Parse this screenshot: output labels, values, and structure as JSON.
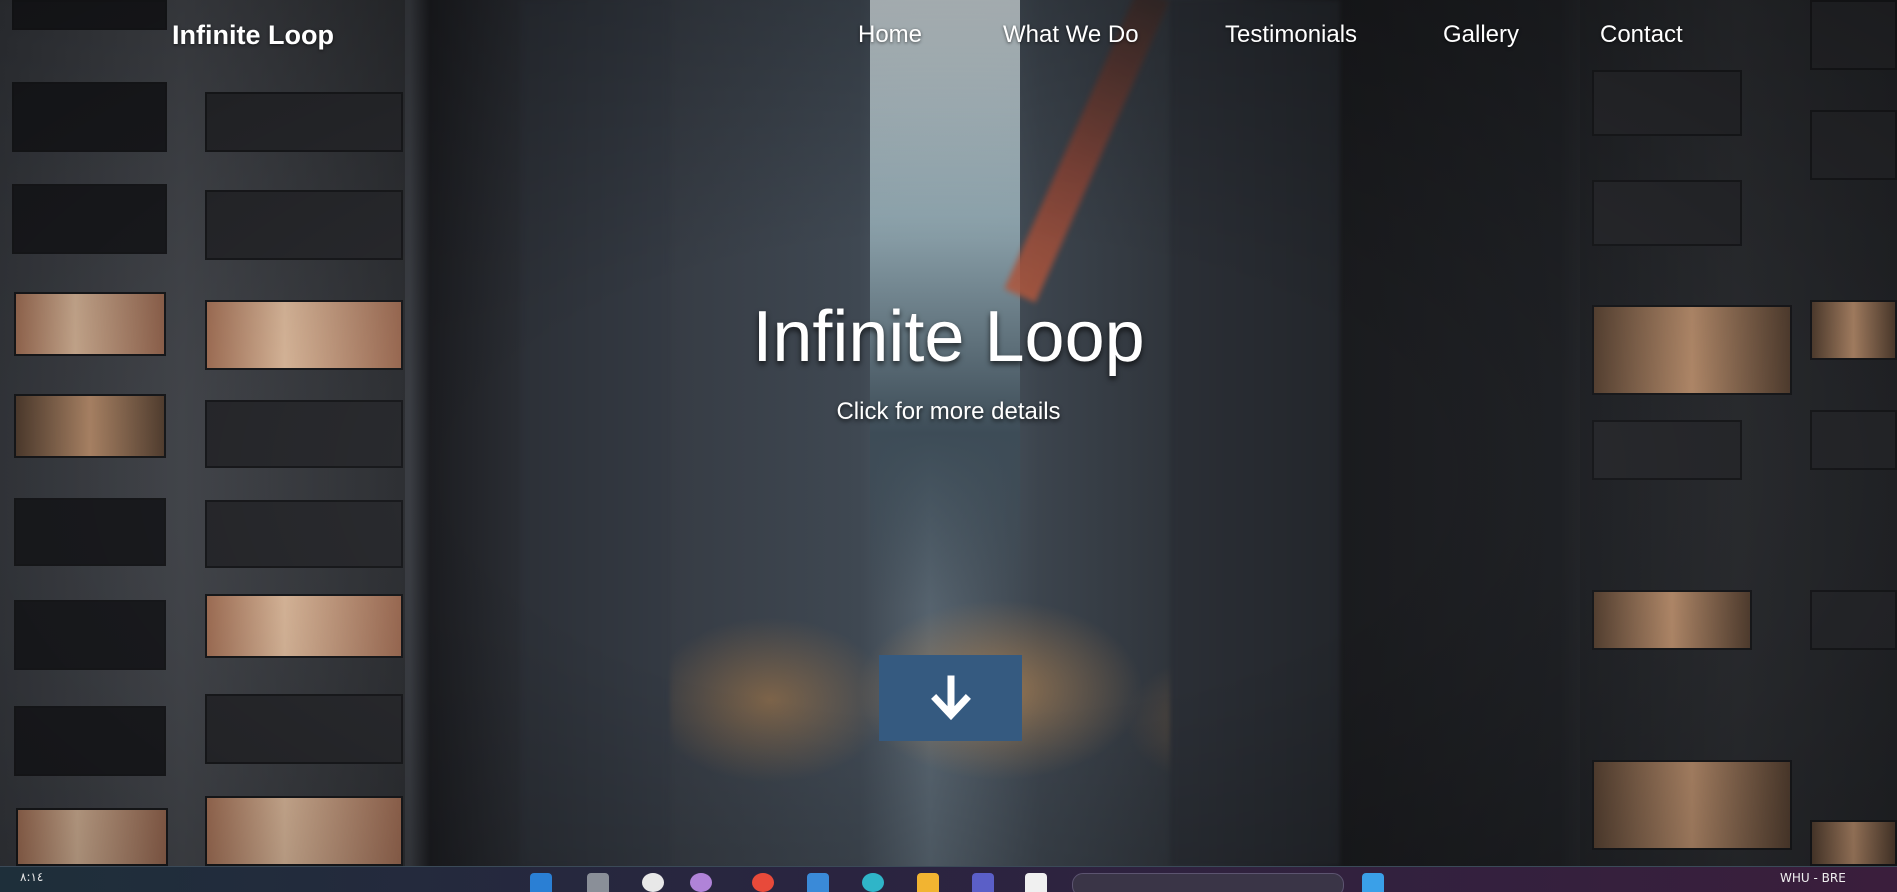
{
  "nav": {
    "brand": "Infinite Loop",
    "links": [
      "Home",
      "What We Do",
      "Testimonials",
      "Gallery",
      "Contact"
    ]
  },
  "hero": {
    "title": "Infinite Loop",
    "subtitle": "Click for more details",
    "button_icon": "arrow-down-icon",
    "button_color": "#355a80"
  },
  "taskbar": {
    "left_text": "٨:١٤",
    "right_text": "WHU - BRE",
    "icons": [
      "vscode-icon",
      "cat-icon",
      "app-icon",
      "app-icon",
      "chrome-icon",
      "store-icon",
      "edge-icon",
      "folder-icon",
      "teams-icon",
      "notepad-icon",
      "search-icon",
      "windows-icon"
    ]
  }
}
